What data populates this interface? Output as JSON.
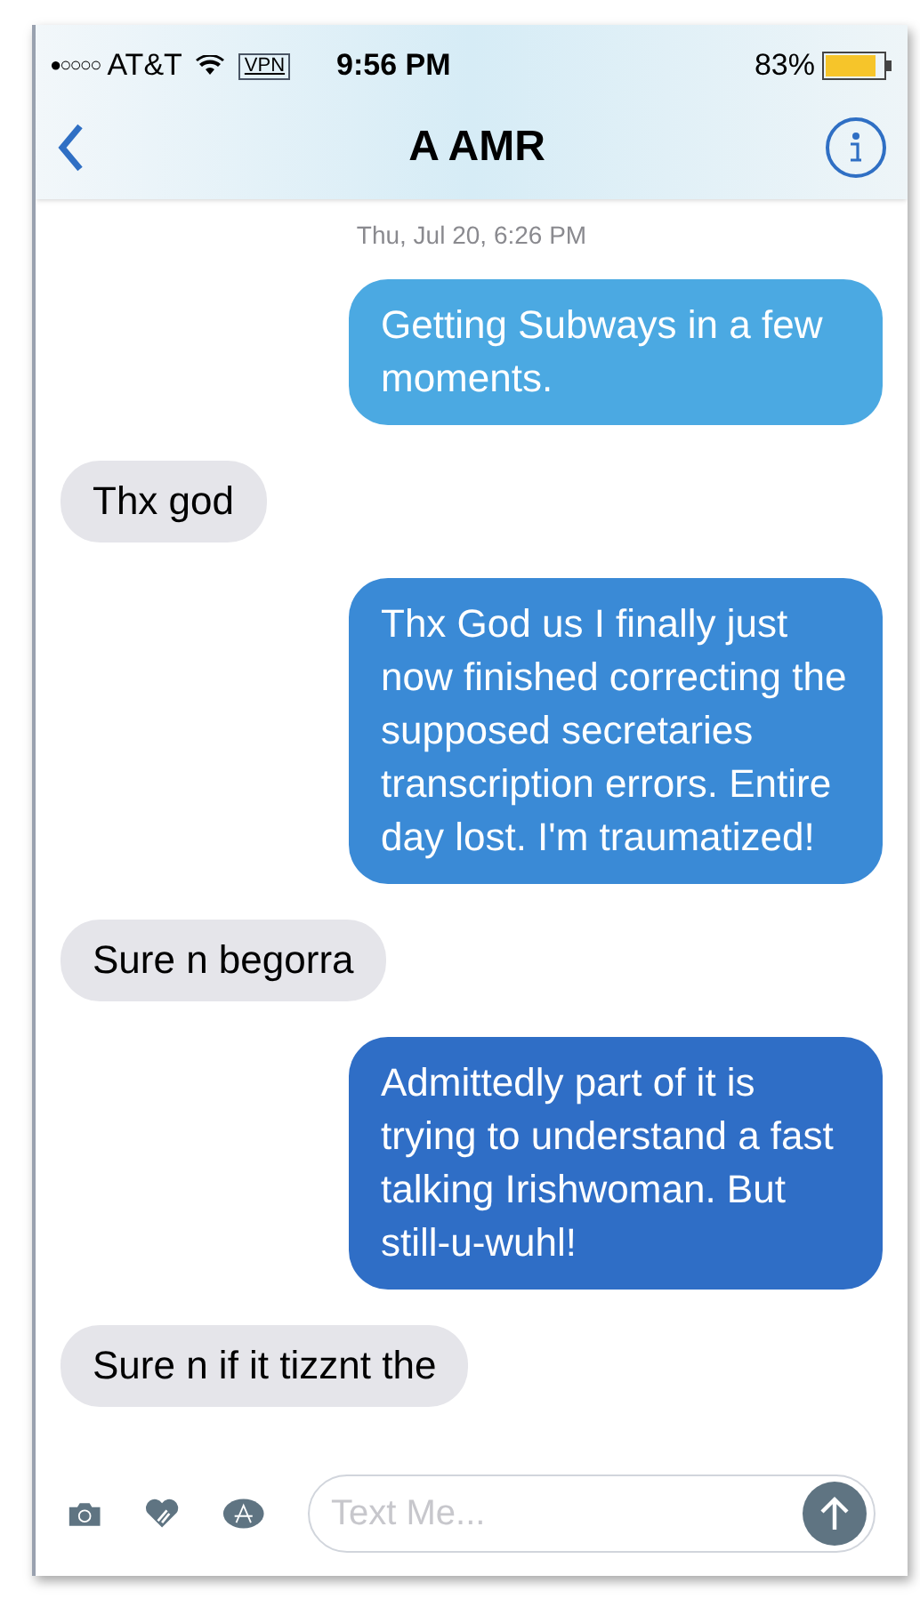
{
  "status_bar": {
    "signal": "●○○○○",
    "carrier": "AT&T",
    "vpn": "VPN",
    "time": "9:56 PM",
    "battery": "83%"
  },
  "nav": {
    "title": "A AMR"
  },
  "timestamp": "Thu, Jul 20, 6:26 PM",
  "messages": [
    {
      "kind": "sent",
      "text": "Getting Subways in a few moments.",
      "color": "#4ba9e2"
    },
    {
      "kind": "received",
      "text": "Thx god"
    },
    {
      "kind": "sent",
      "text": "Thx God us I finally just now finished correcting the supposed secretaries transcription errors. Entire day lost. I'm traumatized!",
      "color": "#3a8ad6"
    },
    {
      "kind": "received",
      "text": "Sure n begorra"
    },
    {
      "kind": "sent",
      "text": "Admittedly part of it is trying to understand a fast talking Irishwoman. But still-u-wuhl!",
      "color": "#2f6ec6"
    },
    {
      "kind": "received",
      "text": "Sure n if it tizznt the"
    }
  ],
  "composer": {
    "placeholder": "Text Me..."
  }
}
